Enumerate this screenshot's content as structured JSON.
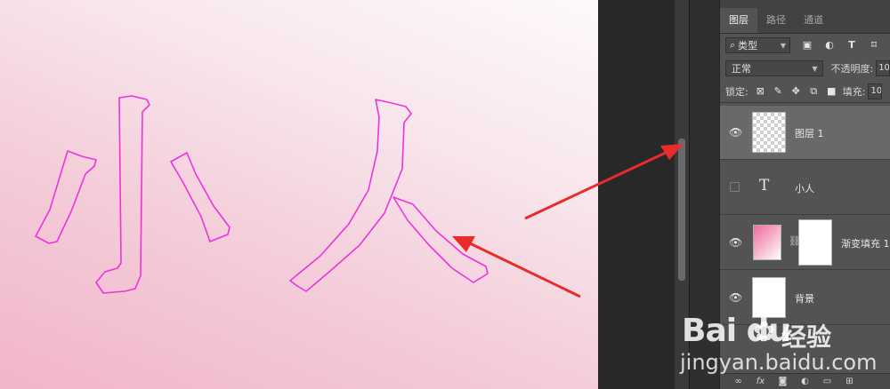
{
  "canvas": {
    "outlined_text": "小人",
    "outline_color": "#ee33dd"
  },
  "layers_panel": {
    "tabs": [
      {
        "label": "图层",
        "active": true
      },
      {
        "label": "路径",
        "active": false
      },
      {
        "label": "通道",
        "active": false
      }
    ],
    "filter": {
      "label": "类型",
      "icon": "search-icon"
    },
    "filter_icons": [
      "image-filter-icon",
      "adjustment-filter-icon",
      "type-filter-icon",
      "shape-filter-icon"
    ],
    "blend_mode": "正常",
    "opacity_label": "不透明度:",
    "opacity_value": "10",
    "lock_label": "锁定:",
    "lock_icons": [
      "lock-transparent-icon",
      "lock-brush-icon",
      "lock-move-icon",
      "lock-artboard-icon",
      "lock-all-icon"
    ],
    "fill_label": "填充:",
    "fill_value": "10",
    "layers": [
      {
        "name": "图层 1",
        "kind": "pixel",
        "selected": true,
        "visible": true
      },
      {
        "name": "小人",
        "kind": "text",
        "selected": false,
        "visible": false
      },
      {
        "name": "渐变填充 1",
        "kind": "gradient",
        "selected": false,
        "visible": true
      },
      {
        "name": "背景",
        "kind": "background",
        "selected": false,
        "visible": true
      }
    ],
    "bottom_icons": [
      "link-layers-icon",
      "fx-icon",
      "mask-icon",
      "adjustment-icon",
      "group-icon",
      "new-layer-icon"
    ]
  },
  "watermark": {
    "logo": "Bai du",
    "logo_suffix": "经验",
    "url": "jingyan.baidu.com"
  },
  "colors": {
    "arrow": "#e82c2c",
    "selected_layer": "#696969",
    "panel_bg": "#535353"
  }
}
